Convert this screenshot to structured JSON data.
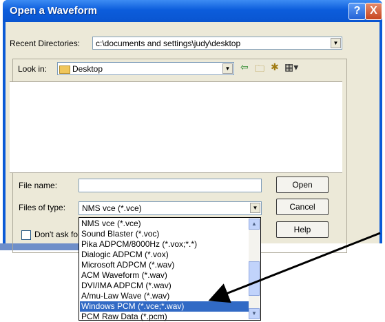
{
  "dialog": {
    "title": "Open a Waveform",
    "help_glyph": "?",
    "close_glyph": "X"
  },
  "recent": {
    "label": "Recent Directories:",
    "value": "c:\\documents and settings\\judy\\desktop"
  },
  "look_in": {
    "label": "Look in:",
    "value": "Desktop"
  },
  "toolbar": {
    "back_glyph": "⇦",
    "up_glyph": "🗀",
    "new_folder_glyph": "✱",
    "view_glyph": "▦▾"
  },
  "file_name": {
    "label": "File name:",
    "value": ""
  },
  "file_type": {
    "label": "Files of type:",
    "value": "NMS vce (*.vce)"
  },
  "buttons": {
    "open": "Open",
    "cancel": "Cancel",
    "help": "Help"
  },
  "dont_ask": {
    "label": "Don't ask fo"
  },
  "type_list": {
    "items": [
      "NMS vce (*.vce)",
      "Sound Blaster (*.voc)",
      "Pika ADPCM/8000Hz (*.vox;*.*)",
      "Dialogic ADPCM (*.vox)",
      "Microsoft ADPCM (*.wav)",
      "ACM Waveform (*.wav)",
      "DVI/IMA ADPCM (*.wav)",
      "A/mu-Law Wave (*.wav)",
      "Windows PCM (*.vce;*.wav)",
      "PCM Raw Data (*.pcm)"
    ],
    "selected": "Windows PCM (*.vce;*.wav)"
  },
  "colors": {
    "titlebar": "#0c5ddc",
    "selection": "#316ac5",
    "dialog_bg": "#ece9d8"
  }
}
